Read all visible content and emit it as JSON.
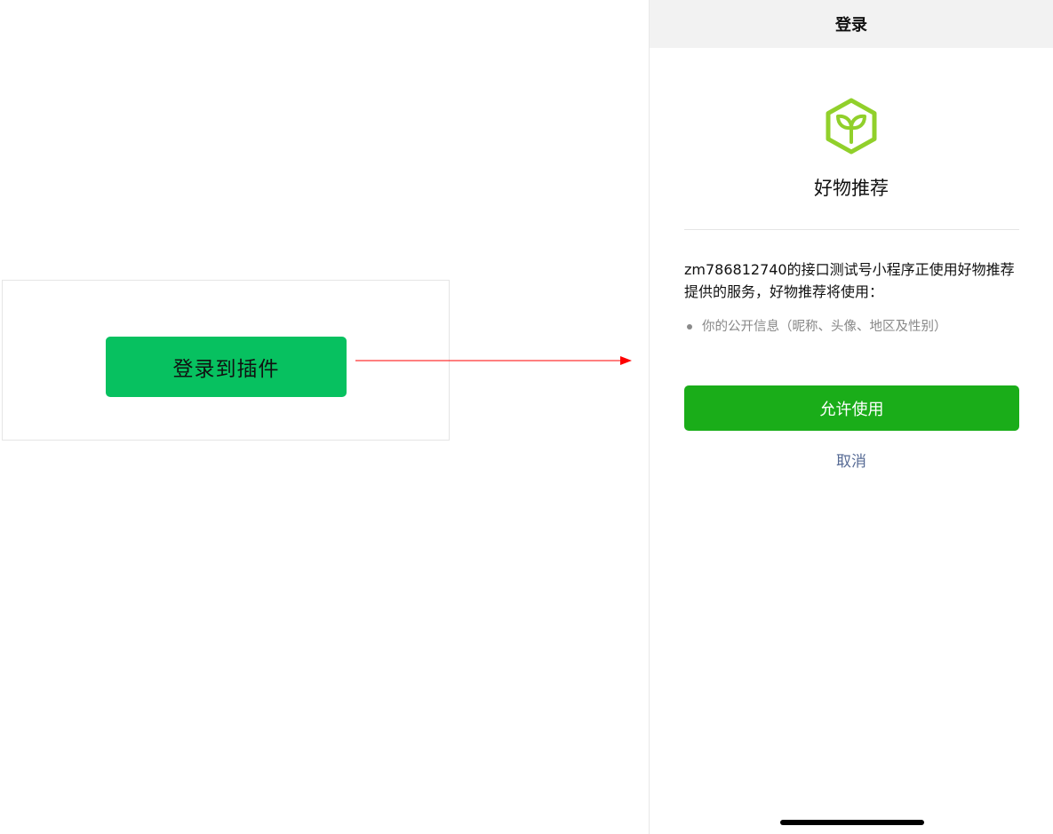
{
  "plugin_card": {
    "button_label": "登录到插件"
  },
  "auth_page": {
    "nav_title": "登录",
    "plugin_name": "好物推荐",
    "logo_icon": "sprout-cube-icon",
    "logo_color": "#91d02b",
    "description": "zm786812740的接口测试号小程序正使用好物推荐提供的服务，好物推荐将使用：",
    "scope_item": "你的公开信息（昵称、头像、地区及性别）",
    "allow_label": "允许使用",
    "cancel_label": "取消"
  },
  "colors": {
    "plugin_button": "#07c160",
    "allow_button": "#1aad19",
    "cancel_link": "#576b95",
    "arrow": "#ff0000"
  }
}
